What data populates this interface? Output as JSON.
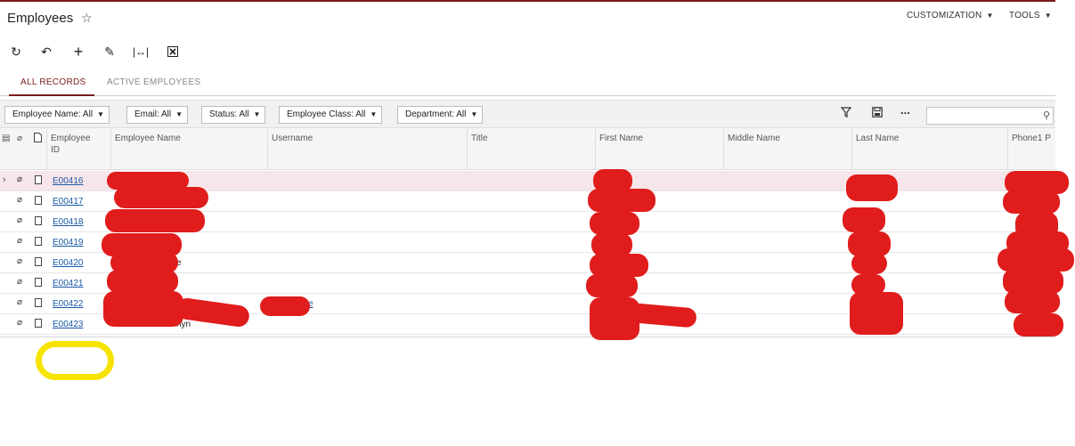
{
  "page": {
    "title": "Employees"
  },
  "top_menu": {
    "customization": "CUSTOMIZATION",
    "tools": "TOOLS"
  },
  "tabs": [
    {
      "label": "ALL RECORDS",
      "active": true
    },
    {
      "label": "ACTIVE EMPLOYEES",
      "active": false
    }
  ],
  "filters": [
    {
      "label": "Employee Name: All"
    },
    {
      "label": "Email: All"
    },
    {
      "label": "Status: All"
    },
    {
      "label": "Employee Class: All"
    },
    {
      "label": "Department: All"
    }
  ],
  "search": {
    "placeholder": ""
  },
  "toolbar": {
    "more_label": "..."
  },
  "columns": {
    "employee_id": "Employee\nID",
    "employee_name": "Employee Name",
    "username": "Username",
    "title": "Title",
    "first_name": "First Name",
    "middle_name": "Middle Name",
    "last_name": "Last Name",
    "phone1": "Phone1 P"
  },
  "rows": [
    {
      "id": "E00416",
      "selected": true,
      "visible_name": "",
      "visible_username": ""
    },
    {
      "id": "E00417",
      "selected": false,
      "visible_name": "",
      "visible_username": ""
    },
    {
      "id": "E00418",
      "selected": false,
      "visible_name": "",
      "visible_username": ""
    },
    {
      "id": "E00419",
      "selected": false,
      "visible_name": "",
      "visible_username": ""
    },
    {
      "id": "E00420",
      "selected": false,
      "visible_name": "e",
      "visible_username": ""
    },
    {
      "id": "E00421",
      "selected": false,
      "visible_name": "",
      "visible_username": ""
    },
    {
      "id": "E00422",
      "selected": false,
      "visible_name": "",
      "visible_username": "e"
    },
    {
      "id": "E00423",
      "selected": false,
      "visible_name": "nyn",
      "visible_username": ""
    }
  ],
  "colors": {
    "accent": "#7a1b1b",
    "link": "#1a5aa8",
    "redaction": "#e01c1c",
    "highlight": "#f7e300",
    "selected_row": "#f6e6e9"
  },
  "icons": [
    "refresh-icon",
    "undo-icon",
    "add-icon",
    "edit-icon",
    "fit-columns-icon",
    "excel-export-icon",
    "star-icon",
    "filter-icon",
    "save-icon",
    "search-icon",
    "paperclip-icon",
    "document-icon",
    "row-arrow-icon"
  ]
}
